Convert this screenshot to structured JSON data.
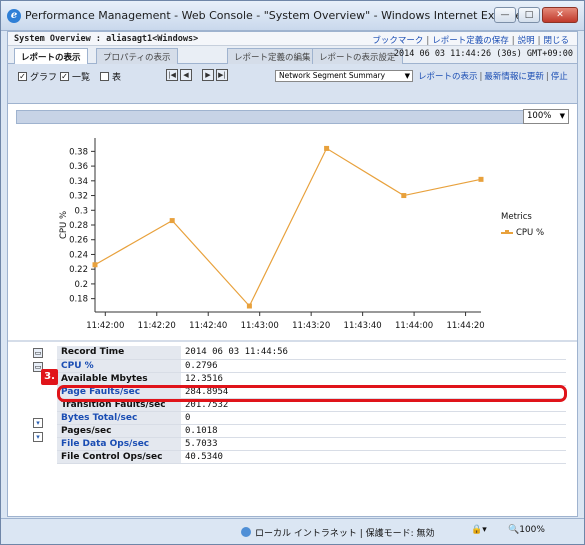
{
  "window": {
    "title": "Performance Management - Web Console - \"System Overview\" - Windows Internet Explorer",
    "buttons": {
      "minimize": "—",
      "maximize": "□",
      "close": "✕"
    }
  },
  "header": {
    "system": "System Overview : aliasagt1<Windows>",
    "links": [
      "ブックマーク",
      "レポート定義の保存",
      "説明",
      "閉じる"
    ],
    "tabs": [
      "レポートの表示",
      "プロパティの表示",
      "レポート定義の編集",
      "レポートの表示設定"
    ],
    "datetime": "2014 06 03 11:44:26 (30s) GMT+09:00"
  },
  "controls": {
    "checkboxes": [
      {
        "label": "グラフ",
        "checked": true
      },
      {
        "label": "一覧",
        "checked": true
      },
      {
        "label": "表",
        "checked": false
      }
    ],
    "nav_buttons": [
      "|◀",
      "◀",
      "▶",
      "▶|"
    ],
    "report_select": "Network Segment Summary",
    "links": [
      "レポートの表示",
      "最新情報に更新",
      "停止"
    ]
  },
  "zoom_select": "100%",
  "chart_data": {
    "type": "line",
    "ylabel": "CPU %",
    "xlabel": "",
    "ylim": [
      0.17,
      0.39
    ],
    "y_ticks": [
      0.18,
      0.2,
      0.22,
      0.24,
      0.26,
      0.28,
      0.3,
      0.32,
      0.34,
      0.36,
      0.38
    ],
    "x_ticks": [
      "11:42:00",
      "11:42:20",
      "11:42:40",
      "11:43:00",
      "11:43:20",
      "11:43:40",
      "11:44:00",
      "11:44:20"
    ],
    "legend_title": "Metrics",
    "series": [
      {
        "name": "CPU %",
        "color": "#e8a13c",
        "points": [
          {
            "x": "11:41:56",
            "y": 0.226
          },
          {
            "x": "11:42:26",
            "y": 0.286
          },
          {
            "x": "11:42:56",
            "y": 0.17
          },
          {
            "x": "11:43:26",
            "y": 0.384
          },
          {
            "x": "11:43:56",
            "y": 0.32
          },
          {
            "x": "11:44:26",
            "y": 0.342
          }
        ]
      }
    ]
  },
  "metrics_table": {
    "rows": [
      {
        "key": "Record Time",
        "value": "2014 06 03 11:44:56",
        "link": false
      },
      {
        "key": "CPU %",
        "value": "0.2796",
        "link": true
      },
      {
        "key": "Available Mbytes",
        "value": "12.3516",
        "link": false
      },
      {
        "key": "Page Faults/sec",
        "value": "284.8954",
        "link": true
      },
      {
        "key": "Transition Faults/sec",
        "value": "201.7532",
        "link": false
      },
      {
        "key": "Bytes Total/sec",
        "value": "0",
        "link": true
      },
      {
        "key": "Pages/sec",
        "value": "0.1018",
        "link": false
      },
      {
        "key": "File Data Ops/sec",
        "value": "5.7033",
        "link": true
      },
      {
        "key": "File Control Ops/sec",
        "value": "40.5340",
        "link": false
      }
    ]
  },
  "callout": "3.",
  "statusbar": {
    "zone": "ローカル イントラネット | 保護モード: 無効",
    "protected_icon": "▾",
    "zoom": "100%"
  }
}
